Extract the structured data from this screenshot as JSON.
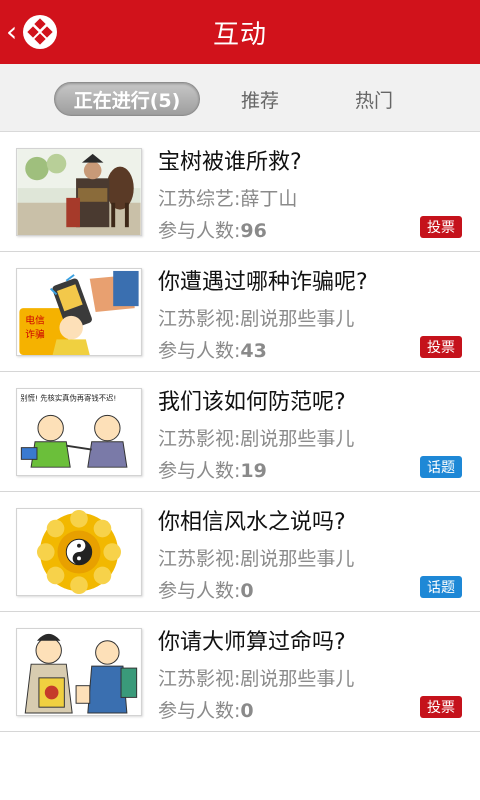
{
  "header": {
    "title": "互动",
    "back_icon": "chevron-left-icon",
    "logo_icon": "jsbc-logo-icon"
  },
  "tabs": [
    {
      "label": "正在进行(5)",
      "active": true
    },
    {
      "label": "推荐",
      "active": false
    },
    {
      "label": "热门",
      "active": false
    }
  ],
  "items": [
    {
      "title": "宝树被谁所救?",
      "source": "江苏综艺:薛丁山",
      "count_label": "参与人数:",
      "count": "96",
      "badge": "投票",
      "badge_color": "#c5121b"
    },
    {
      "title": "你遭遇过哪种诈骗呢?",
      "source": "江苏影视:剧说那些事儿",
      "count_label": "参与人数:",
      "count": "43",
      "badge": "投票",
      "badge_color": "#c5121b"
    },
    {
      "title": "我们该如何防范呢?",
      "source": "江苏影视:剧说那些事儿",
      "count_label": "参与人数:",
      "count": "19",
      "badge": "话题",
      "badge_color": "#1e88d6"
    },
    {
      "title": "你相信风水之说吗?",
      "source": "江苏影视:剧说那些事儿",
      "count_label": "参与人数:",
      "count": "0",
      "badge": "话题",
      "badge_color": "#1e88d6"
    },
    {
      "title": "你请大师算过命吗?",
      "source": "江苏影视:剧说那些事儿",
      "count_label": "参与人数:",
      "count": "0",
      "badge": "投票",
      "badge_color": "#c5121b"
    }
  ],
  "thumbs": {
    "cartoon_caption": "别慌! 先核实真伪再寄钱不迟!",
    "phone_label": "电信诈骗"
  }
}
